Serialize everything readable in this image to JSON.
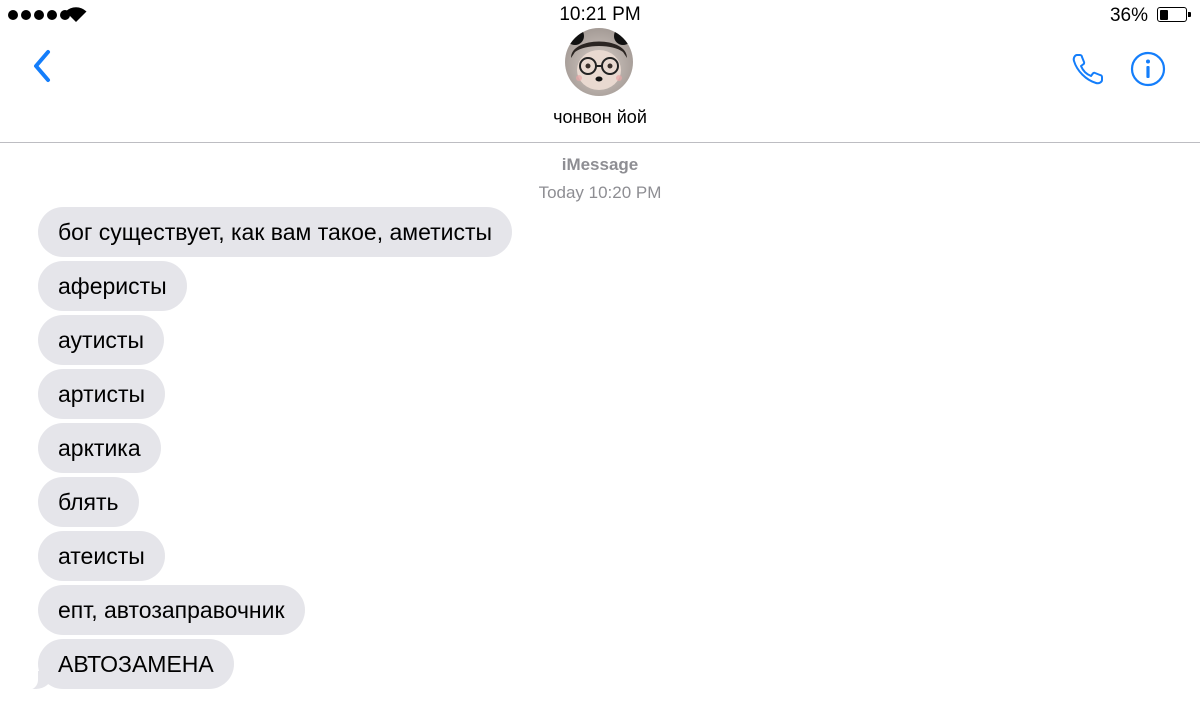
{
  "status_bar": {
    "time": "10:21 PM",
    "battery_percent_label": "36%",
    "battery_level": 0.36
  },
  "header": {
    "contact_name": "чонвон йой",
    "accent_color": "#147efb"
  },
  "thread": {
    "service": "iMessage",
    "timestamp": "Today 10:20 PM",
    "messages": [
      "бог существует, как вам такое, аметисты",
      "аферисты",
      "аутисты",
      "артисты",
      "арктика",
      "блять",
      "атеисты",
      "епт, автозаправочник",
      "АВТОЗАМЕНА"
    ],
    "bubble_color": "#e5e5ea"
  }
}
